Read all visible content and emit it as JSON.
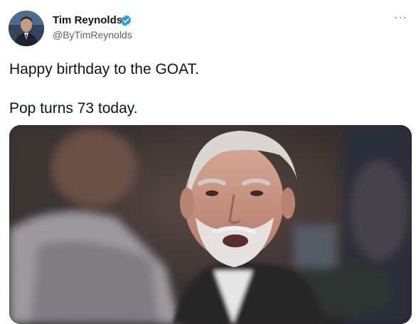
{
  "tweet": {
    "author": {
      "name": "Tim Reynolds",
      "handle": "@ByTimReynolds",
      "verified": true,
      "avatar_icon": "avatar-photo"
    },
    "more_icon": "ellipsis-icon",
    "more_label": "···",
    "text_lines": [
      "Happy birthday to the GOAT.",
      "Pop turns 73 today."
    ],
    "media": {
      "type": "photo",
      "description_icon": "coach-photo"
    }
  },
  "colors": {
    "text": "#0f1419",
    "secondary": "#536471",
    "verified": "#1d9bf0"
  }
}
